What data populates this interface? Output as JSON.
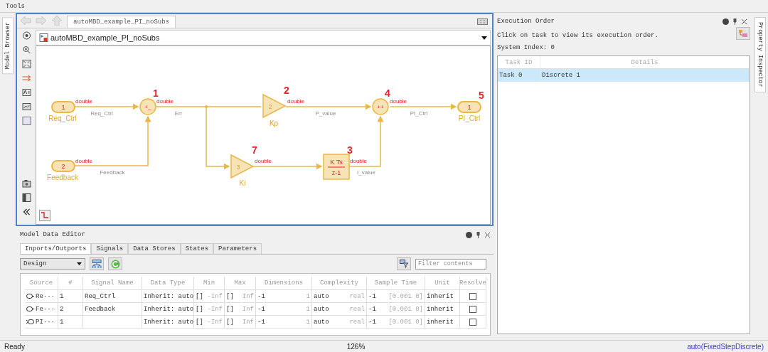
{
  "menu": [
    "Tools"
  ],
  "left_dock": {
    "tab": "Model Browser"
  },
  "right_dock": {
    "tab": "Property Inspector"
  },
  "editor": {
    "tab": "autoMBD_example_PI_noSubs",
    "address": "autoMBD_example_PI_noSubs",
    "blocks": [
      {
        "kind": "inport",
        "text": "1",
        "name": "Req_Ctrl"
      },
      {
        "kind": "inport",
        "text": "2",
        "name": "Feedback"
      },
      {
        "kind": "sum",
        "text": "+_",
        "order": "1"
      },
      {
        "kind": "gain",
        "text": "2",
        "name": "Kp",
        "order": "2"
      },
      {
        "kind": "sum",
        "text": "++",
        "order": "4"
      },
      {
        "kind": "outport",
        "text": "1",
        "name": "PI_Ctrl",
        "order": "5"
      },
      {
        "kind": "gain",
        "text": "3",
        "name": "Ki",
        "order": "7"
      },
      {
        "kind": "discrete",
        "numerator": "K Ts",
        "denominator": "z-1",
        "order": "3"
      }
    ],
    "signals": [
      {
        "datatype": "double",
        "name": "Req_Ctrl"
      },
      {
        "datatype": "double",
        "name": "Err"
      },
      {
        "datatype": "double",
        "name": "P_value"
      },
      {
        "datatype": "double",
        "name": "PI_Ctrl"
      },
      {
        "datatype": "double",
        "name": "Feedback"
      },
      {
        "datatype": "double"
      },
      {
        "datatype": "double",
        "name": "I_value"
      }
    ]
  },
  "data_editor": {
    "title": "Model Data Editor",
    "tabs": [
      {
        "label": "Inports/Outports",
        "selected": true
      },
      {
        "label": "Signals",
        "selected": false
      },
      {
        "label": "Data Stores",
        "selected": false
      },
      {
        "label": "States",
        "selected": false
      },
      {
        "label": "Parameters",
        "selected": false
      }
    ],
    "view": "Design",
    "filter": {
      "placeholder": "Filter contents"
    },
    "columns": [
      "Source",
      "#",
      "Signal Name",
      "Data Type",
      "Min",
      "Max",
      "Dimensions",
      "Complexity",
      "Sample Time",
      "Unit",
      "Resolve"
    ],
    "rows": [
      {
        "kind": "inport",
        "source": "Re···",
        "number": "1",
        "signal_name": "Req_Ctrl",
        "data_type": "Inherit: auto",
        "min": "[]",
        "min_value": "-Inf",
        "max": "[]",
        "max_value": "Inf",
        "dimensions": "-1",
        "dimensions_value": "1",
        "complexity": "auto",
        "complexity_value": "real",
        "sample_time": "-1",
        "sample_time_value": "[0.001 0]",
        "unit": "inherit",
        "resolve": false
      },
      {
        "kind": "inport",
        "source": "Fe···",
        "number": "2",
        "signal_name": "Feedback",
        "data_type": "Inherit: auto",
        "min": "[]",
        "min_value": "-Inf",
        "max": "[]",
        "max_value": "Inf",
        "dimensions": "-1",
        "dimensions_value": "1",
        "complexity": "auto",
        "complexity_value": "real",
        "sample_time": "-1",
        "sample_time_value": "[0.001 0]",
        "unit": "inherit",
        "resolve": false
      },
      {
        "kind": "outport",
        "source": "PI···",
        "number": "1",
        "data_type": "Inherit: auto",
        "min": "[]",
        "min_value": "-Inf",
        "max": "[]",
        "max_value": "Inf",
        "dimensions": "-1",
        "dimensions_value": "1",
        "complexity": "auto",
        "complexity_value": "real",
        "sample_time": "-1",
        "sample_time_value": "[0.001 0]",
        "unit": "inherit",
        "resolve": false
      }
    ]
  },
  "execution_order": {
    "title": "Execution Order",
    "hint": "Click on task to view its execution order.",
    "system_index": "System Index: 0",
    "columns": [
      "Task ID",
      "Details"
    ],
    "rows": [
      {
        "task_id": "Task 0",
        "details": "Discrete 1",
        "selected": true
      }
    ]
  },
  "status_bar": {
    "left": "Ready",
    "zoom": "126%",
    "solver": "auto(FixedStepDiscrete)"
  }
}
